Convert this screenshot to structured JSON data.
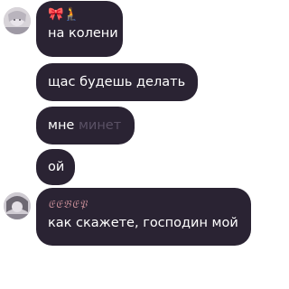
{
  "messages": [
    {
      "sender_emoji": "🎀🧎",
      "text": "на колени"
    },
    {
      "text": "щас будешь делать"
    },
    {
      "text_visible": "мне",
      "text_faded": "минет"
    },
    {
      "text": "ой"
    },
    {
      "sender_name": "𝔈𝔈𝔅𝔈𝔓",
      "text": "как скажете, господин мой"
    }
  ],
  "colors": {
    "bubble": "#2a2333",
    "text": "#ffffff",
    "faded_text": "#5a5165",
    "sender_name": "#c28a94",
    "background": "#ffffff"
  }
}
